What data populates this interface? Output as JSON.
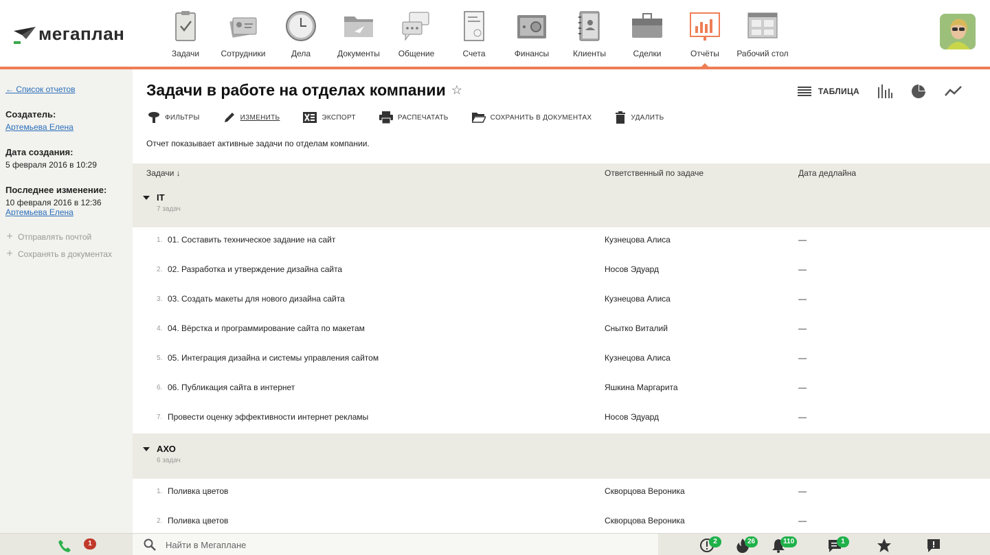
{
  "app": {
    "logo_text": "мегаплан",
    "colors": {
      "accent": "#ef7e55",
      "link": "#2a6ebb",
      "badge_green": "#1fb14a",
      "badge_red": "#c0392b"
    }
  },
  "nav": {
    "items": [
      {
        "label": "Задачи",
        "icon": "tasks-clipboard-icon"
      },
      {
        "label": "Сотрудники",
        "icon": "employees-card-icon"
      },
      {
        "label": "Дела",
        "icon": "clock-icon"
      },
      {
        "label": "Документы",
        "icon": "documents-folder-icon"
      },
      {
        "label": "Общение",
        "icon": "chat-bubbles-icon"
      },
      {
        "label": "Счета",
        "icon": "invoice-icon"
      },
      {
        "label": "Финансы",
        "icon": "safe-icon"
      },
      {
        "label": "Клиенты",
        "icon": "address-book-icon"
      },
      {
        "label": "Сделки",
        "icon": "briefcase-icon"
      },
      {
        "label": "Отчёты",
        "icon": "report-chart-icon",
        "active": true
      },
      {
        "label": "Рабочий стол",
        "icon": "desktop-icon"
      }
    ]
  },
  "sidebar": {
    "back_link": "← Список отчетов",
    "creator_label": "Создатель:",
    "creator": "Артемьева Елена",
    "created_label": "Дата создания:",
    "created": "5 февраля 2016 в 10:29",
    "modified_label": "Последнее изменение:",
    "modified": "10 февраля 2016 в 12:36",
    "modified_by": "Артемьева Елена",
    "actions": [
      "Отправлять почтой",
      "Сохранять в документах"
    ]
  },
  "report": {
    "title": "Задачи в работе на отделах компании",
    "view_table": "ТАБЛИЦА",
    "toolbar": {
      "filters": "ФИЛЬТРЫ",
      "edit": "ИЗМЕНИТЬ",
      "export": "ЭКСПОРТ",
      "print": "РАСПЕЧАТАТЬ",
      "save_docs": "СОХРАНИТЬ В ДОКУМЕНТАХ",
      "delete": "УДАЛИТЬ"
    },
    "description": "Отчет показывает активные задачи по отделам компании.",
    "columns": {
      "task": "Задачи ↓",
      "responsible": "Ответственный по задаче",
      "deadline": "Дата дедлайна"
    },
    "groups": [
      {
        "name": "IT",
        "count": "7 задач",
        "rows": [
          {
            "num": "1.",
            "task": "01. Составить техническое задание на сайт",
            "responsible": "Кузнецова Алиса",
            "deadline": "—"
          },
          {
            "num": "2.",
            "task": "02. Разработка и утверждение дизайна сайта",
            "responsible": "Носов Эдуард",
            "deadline": "—"
          },
          {
            "num": "3.",
            "task": "03. Создать макеты для нового дизайна сайта",
            "responsible": "Кузнецова Алиса",
            "deadline": "—"
          },
          {
            "num": "4.",
            "task": "04. Вёрстка и программирование сайта по макетам",
            "responsible": "Снытко Виталий",
            "deadline": "—"
          },
          {
            "num": "5.",
            "task": "05. Интеграция дизайна и системы управления сайтом",
            "responsible": "Кузнецова Алиса",
            "deadline": "—"
          },
          {
            "num": "6.",
            "task": "06. Публикация сайта в интернет",
            "responsible": "Яшкина Маргарита",
            "deadline": "—"
          },
          {
            "num": "7.",
            "task": "Провести оценку эффективности интернет рекламы",
            "responsible": "Носов Эдуард",
            "deadline": "—"
          }
        ]
      },
      {
        "name": "АХО",
        "count": "6 задач",
        "rows": [
          {
            "num": "1.",
            "task": "Поливка цветов",
            "responsible": "Скворцова Вероника",
            "deadline": "—"
          },
          {
            "num": "2.",
            "task": "Поливка цветов",
            "responsible": "Скворцова Вероника",
            "deadline": "—"
          }
        ]
      }
    ]
  },
  "footer": {
    "calls_badge": "1",
    "search_placeholder": "Найти в Мегаплане",
    "badges": {
      "alerts": "2",
      "hot": "26",
      "notifications": "110",
      "messages": "1"
    }
  }
}
